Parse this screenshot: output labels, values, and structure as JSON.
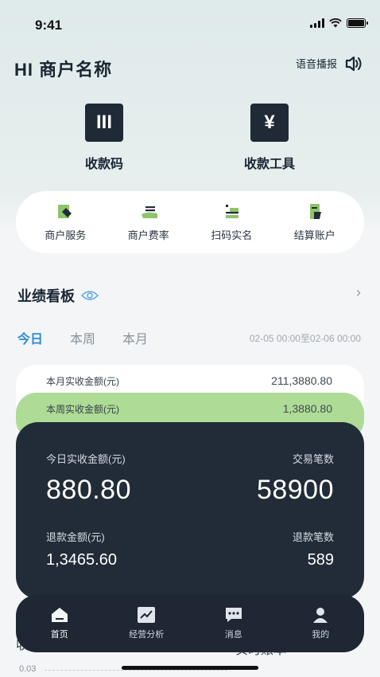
{
  "status": {
    "time": "9:41"
  },
  "header": {
    "merchant_name": "HI 商户名称",
    "voice_label": "语音播报"
  },
  "quick_actions": [
    {
      "label": "收款码",
      "icon": "barcode-icon",
      "glyph": "III"
    },
    {
      "label": "收款工具",
      "icon": "yen-icon",
      "glyph": "¥"
    }
  ],
  "tools": [
    {
      "label": "商户服务",
      "icon": "merchant-service-icon"
    },
    {
      "label": "商户费率",
      "icon": "merchant-rate-icon"
    },
    {
      "label": "扫码实名",
      "icon": "scan-verify-icon"
    },
    {
      "label": "结算账户",
      "icon": "settlement-account-icon"
    }
  ],
  "dashboard": {
    "title": "业绩看板",
    "tabs": [
      "今日",
      "本周",
      "本月"
    ],
    "active_tab": "今日",
    "range": "02-05 00:00至02-06 00:00",
    "month": {
      "label": "本月实收金额(元)",
      "value": "211,3880.80"
    },
    "week": {
      "label": "本周实收金额(元)",
      "value": "1,3880.80"
    },
    "today": {
      "income_label": "今日实收金额(元)",
      "income_value": "880.80",
      "tx_label": "交易笔数",
      "tx_value": "58900",
      "refund_label": "退款金额(元)",
      "refund_value": "1,3465.60",
      "refund_count_label": "退款笔数",
      "refund_count_value": "589"
    }
  },
  "bottom_nav": [
    {
      "label": "首页",
      "icon": "home-icon",
      "active": true
    },
    {
      "label": "经营分析",
      "icon": "trend-chart-icon"
    },
    {
      "label": "消息",
      "icon": "message-icon"
    },
    {
      "label": "我的",
      "icon": "profile-icon"
    }
  ],
  "under_nav": {
    "left": "收入趋势",
    "right": "实时账本",
    "axis_value": "0.03"
  },
  "colors": {
    "accent": "#2a8cde",
    "dark": "#222c38",
    "green": "#aedb95"
  }
}
